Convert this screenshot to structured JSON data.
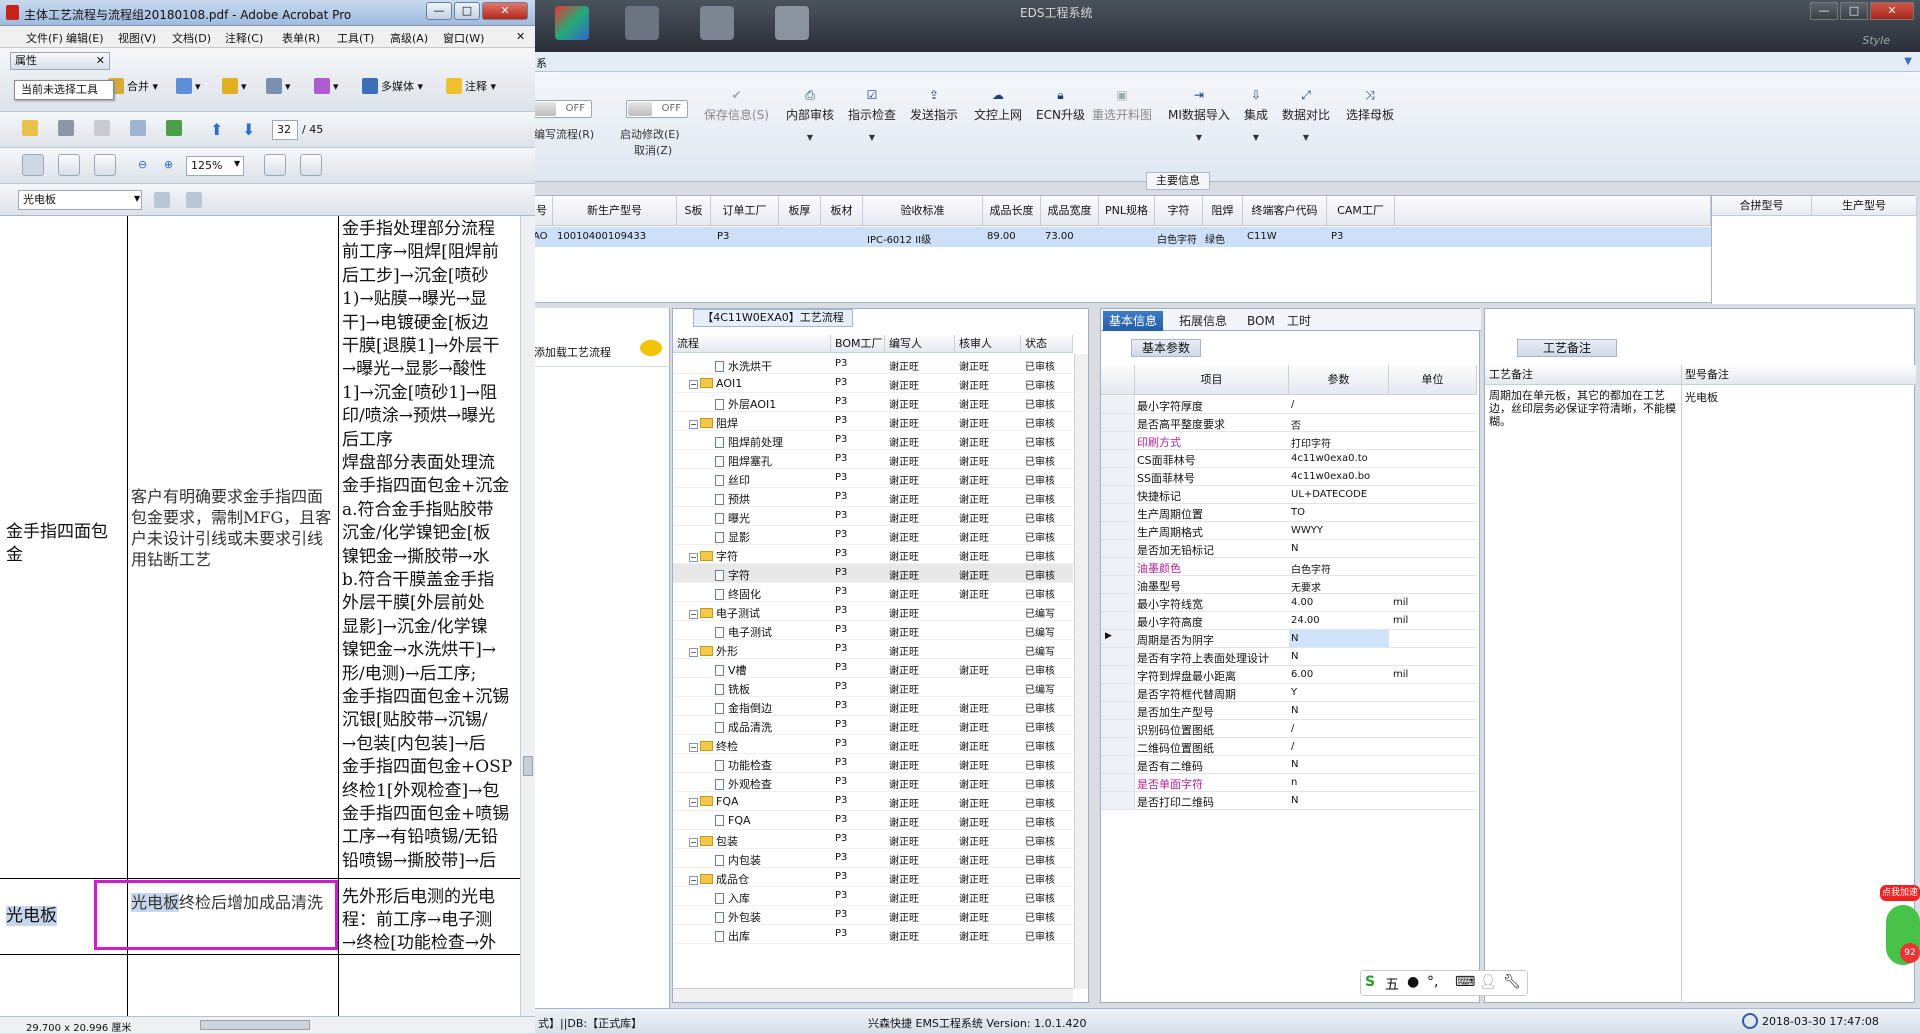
{
  "eds": {
    "title": "EDS工程系统",
    "style_label": "Style",
    "menu_tab": "系",
    "toggles": [
      {
        "value": "OFF",
        "label": "编写流程(R)"
      },
      {
        "value": "OFF",
        "label": "启动修改(E)",
        "label2": "取消(Z)"
      }
    ],
    "ribbon": [
      {
        "label": "保存信息(S)",
        "disabled": true
      },
      {
        "label": "内部审核"
      },
      {
        "label": "指示检查"
      },
      {
        "label": "发送指示"
      },
      {
        "label": "文控上网"
      },
      {
        "label": "ECN升级"
      },
      {
        "label": "重选开料图",
        "disabled": true
      },
      {
        "label": "MI数据导入"
      },
      {
        "label": "集成"
      },
      {
        "label": "数据对比"
      },
      {
        "label": "选择母板"
      }
    ],
    "group_label": "主要信息",
    "info_headers": [
      "号",
      "新生产型号",
      "S板",
      "订单工厂",
      "板厚",
      "板材",
      "验收标准",
      "成品长度",
      "成品宽度",
      "PNL规格",
      "字符",
      "阻焊",
      "终端客户代码",
      "CAM工厂"
    ],
    "info_headers_right": [
      "合拼型号",
      "生产型号"
    ],
    "info_row": [
      "AO",
      "10010400109433",
      "",
      "P3",
      "",
      "",
      "IPC-6012 II级",
      "89.00",
      "73.00",
      "",
      "白色字符",
      "绿色",
      "C11W",
      "P3"
    ],
    "process_panel": {
      "add_label": "添加载工艺流程"
    },
    "tree": {
      "title": "【4C11W0EXA0】工艺流程",
      "headers": [
        "流程",
        "BOM工厂",
        "编写人",
        "核审人",
        "状态"
      ],
      "rows": [
        {
          "name": "水洗烘干",
          "type": "doc",
          "level": 2,
          "bom": "P3",
          "writer": "谢正旺",
          "reviewer": "谢正旺",
          "status": "已审核"
        },
        {
          "name": "AOI1",
          "type": "folder",
          "level": 1,
          "bom": "P3",
          "writer": "谢正旺",
          "reviewer": "谢正旺",
          "status": "已审核"
        },
        {
          "name": "外层AOI1",
          "type": "doc",
          "level": 2,
          "bom": "P3",
          "writer": "谢正旺",
          "reviewer": "谢正旺",
          "status": "已审核"
        },
        {
          "name": "阻焊",
          "type": "folder",
          "level": 1,
          "bom": "P3",
          "writer": "谢正旺",
          "reviewer": "谢正旺",
          "status": "已审核"
        },
        {
          "name": "阻焊前处理",
          "type": "doc",
          "level": 2,
          "bom": "P3",
          "writer": "谢正旺",
          "reviewer": "谢正旺",
          "status": "已审核"
        },
        {
          "name": "阻焊塞孔",
          "type": "doc",
          "level": 2,
          "bom": "P3",
          "writer": "谢正旺",
          "reviewer": "谢正旺",
          "status": "已审核"
        },
        {
          "name": "丝印",
          "type": "doc",
          "level": 2,
          "bom": "P3",
          "writer": "谢正旺",
          "reviewer": "谢正旺",
          "status": "已审核"
        },
        {
          "name": "预烘",
          "type": "doc",
          "level": 2,
          "bom": "P3",
          "writer": "谢正旺",
          "reviewer": "谢正旺",
          "status": "已审核"
        },
        {
          "name": "曝光",
          "type": "doc",
          "level": 2,
          "bom": "P3",
          "writer": "谢正旺",
          "reviewer": "谢正旺",
          "status": "已审核"
        },
        {
          "name": "显影",
          "type": "doc",
          "level": 2,
          "bom": "P3",
          "writer": "谢正旺",
          "reviewer": "谢正旺",
          "status": "已审核"
        },
        {
          "name": "字符",
          "type": "folder",
          "level": 1,
          "bom": "P3",
          "writer": "谢正旺",
          "reviewer": "谢正旺",
          "status": "已审核"
        },
        {
          "name": "字符",
          "type": "doc",
          "level": 2,
          "bom": "P3",
          "writer": "谢正旺",
          "reviewer": "谢正旺",
          "status": "已审核",
          "selected": true
        },
        {
          "name": "终固化",
          "type": "doc",
          "level": 2,
          "bom": "P3",
          "writer": "谢正旺",
          "reviewer": "谢正旺",
          "status": "已审核"
        },
        {
          "name": "电子测试",
          "type": "folder",
          "level": 1,
          "bom": "P3",
          "writer": "谢正旺",
          "reviewer": "",
          "status": "已编写"
        },
        {
          "name": "电子测试",
          "type": "doc",
          "level": 2,
          "bom": "P3",
          "writer": "谢正旺",
          "reviewer": "",
          "status": "已编写"
        },
        {
          "name": "外形",
          "type": "folder",
          "level": 1,
          "bom": "P3",
          "writer": "谢正旺",
          "reviewer": "",
          "status": "已编写"
        },
        {
          "name": "V槽",
          "type": "doc",
          "level": 2,
          "bom": "P3",
          "writer": "谢正旺",
          "reviewer": "谢正旺",
          "status": "已审核"
        },
        {
          "name": "铣板",
          "type": "doc",
          "level": 2,
          "bom": "P3",
          "writer": "谢正旺",
          "reviewer": "",
          "status": "已编写"
        },
        {
          "name": "金指倒边",
          "type": "doc",
          "level": 2,
          "bom": "P3",
          "writer": "谢正旺",
          "reviewer": "谢正旺",
          "status": "已审核"
        },
        {
          "name": "成品清洗",
          "type": "doc",
          "level": 2,
          "bom": "P3",
          "writer": "谢正旺",
          "reviewer": "谢正旺",
          "status": "已审核"
        },
        {
          "name": "终检",
          "type": "folder",
          "level": 1,
          "bom": "P3",
          "writer": "谢正旺",
          "reviewer": "谢正旺",
          "status": "已审核"
        },
        {
          "name": "功能检查",
          "type": "doc",
          "level": 2,
          "bom": "P3",
          "writer": "谢正旺",
          "reviewer": "谢正旺",
          "status": "已审核"
        },
        {
          "name": "外观检查",
          "type": "doc",
          "level": 2,
          "bom": "P3",
          "writer": "谢正旺",
          "reviewer": "谢正旺",
          "status": "已审核"
        },
        {
          "name": "FQA",
          "type": "folder",
          "level": 1,
          "bom": "P3",
          "writer": "谢正旺",
          "reviewer": "谢正旺",
          "status": "已审核"
        },
        {
          "name": "FQA",
          "type": "doc",
          "level": 2,
          "bom": "P3",
          "writer": "谢正旺",
          "reviewer": "谢正旺",
          "status": "已审核"
        },
        {
          "name": "包装",
          "type": "folder",
          "level": 1,
          "bom": "P3",
          "writer": "谢正旺",
          "reviewer": "谢正旺",
          "status": "已审核"
        },
        {
          "name": "内包装",
          "type": "doc",
          "level": 2,
          "bom": "P3",
          "writer": "谢正旺",
          "reviewer": "谢正旺",
          "status": "已审核"
        },
        {
          "name": "成品仓",
          "type": "folder",
          "level": 1,
          "bom": "P3",
          "writer": "谢正旺",
          "reviewer": "谢正旺",
          "status": "已审核"
        },
        {
          "name": "入库",
          "type": "doc",
          "level": 2,
          "bom": "P3",
          "writer": "谢正旺",
          "reviewer": "谢正旺",
          "status": "已审核"
        },
        {
          "name": "外包装",
          "type": "doc",
          "level": 2,
          "bom": "P3",
          "writer": "谢正旺",
          "reviewer": "谢正旺",
          "status": "已审核"
        },
        {
          "name": "出库",
          "type": "doc",
          "level": 2,
          "bom": "P3",
          "writer": "谢正旺",
          "reviewer": "谢正旺",
          "status": "已审核"
        }
      ]
    },
    "basic": {
      "tabs": [
        "基本信息",
        "拓展信息",
        "BOM",
        "工时"
      ],
      "subtab": "基本参数",
      "headers": [
        "项目",
        "参数",
        "单位"
      ],
      "rows": [
        {
          "k": "最小字符厚度",
          "v": "/",
          "u": ""
        },
        {
          "k": "是否高平整度要求",
          "v": "否",
          "u": ""
        },
        {
          "k": "印刷方式",
          "v": "打印字符",
          "u": "",
          "purple": true
        },
        {
          "k": "CS面菲林号",
          "v": "4c11w0exa0.to",
          "u": ""
        },
        {
          "k": "SS面菲林号",
          "v": "4c11w0exa0.bo",
          "u": ""
        },
        {
          "k": "快捷标记",
          "v": "UL+DATECODE",
          "u": ""
        },
        {
          "k": "生产周期位置",
          "v": "TO",
          "u": ""
        },
        {
          "k": "生产周期格式",
          "v": "WWYY",
          "u": ""
        },
        {
          "k": "是否加无铅标记",
          "v": "N",
          "u": ""
        },
        {
          "k": "油墨颜色",
          "v": "白色字符",
          "u": "",
          "purple": true
        },
        {
          "k": "油墨型号",
          "v": "无要求",
          "u": ""
        },
        {
          "k": "最小字符线宽",
          "v": "4.00",
          "u": "mil"
        },
        {
          "k": "最小字符高度",
          "v": "24.00",
          "u": "mil"
        },
        {
          "k": "周期是否为阴字",
          "v": "N",
          "u": "",
          "highlight": true
        },
        {
          "k": "是否有字符上表面处理设计",
          "v": "N",
          "u": ""
        },
        {
          "k": "字符到焊盘最小距离",
          "v": "6.00",
          "u": "mil"
        },
        {
          "k": "是否字符框代替周期",
          "v": "Y",
          "u": ""
        },
        {
          "k": "是否加生产型号",
          "v": "N",
          "u": ""
        },
        {
          "k": "识别码位置图纸",
          "v": "/",
          "u": ""
        },
        {
          "k": "二维码位置图纸",
          "v": "/",
          "u": ""
        },
        {
          "k": "是否有二维码",
          "v": "N",
          "u": ""
        },
        {
          "k": "是否单面字符",
          "v": "n",
          "u": "",
          "purple": true
        },
        {
          "k": "是否打印二维码",
          "v": "N",
          "u": ""
        }
      ]
    },
    "remarks": {
      "subtab": "工艺备注",
      "col1": "工艺备注",
      "col2": "型号备注",
      "note": "周期加在单元板，其它的都加在工艺边，丝印层务必保证字符清晰，不能模糊。",
      "model_note": "光电板"
    },
    "status": {
      "left": "式】||DB:【正式库】",
      "center": "兴森快捷 EMS工程系统 Version: 1.0.1.420",
      "datetime": "2018-03-30 17:47:08"
    },
    "ime": {
      "label": "五"
    },
    "widget": {
      "badge": "点我加速",
      "num": "92"
    }
  },
  "acrobat": {
    "title": "主体工艺流程与流程组20180108.pdf - Adobe Acrobat Pro",
    "menu": [
      "文件(F)",
      "编辑(E)",
      "视图(V)",
      "文档(D)",
      "注释(C)",
      "表单(R)",
      "工具(T)",
      "高级(A)",
      "窗口(W)"
    ],
    "attr_label": "属性",
    "tooltip": "当前未选择工具",
    "tb1": [
      "合并",
      "多媒体",
      "注释"
    ],
    "page_current": "32",
    "page_total": "/ 45",
    "zoom": "125%",
    "search_value": "光电板",
    "doc": {
      "right_lines": [
        "金手指处理部分流程",
        "前工序→阻焊[阻焊前",
        "后工步]→沉金[喷砂",
        "1)→贴膜→曝光→显",
        "干]→电镀硬金[板边",
        "干膜[退膜1]→外层干",
        "→曝光→显影→酸性",
        "1]→沉金[喷砂1]→阻",
        "印/喷涂→预烘→曝光",
        "后工序",
        "焊盘部分表面处理流",
        "金手指四面包金+沉金",
        "a.符合金手指贴胶带",
        "沉金/化学镍钯金[板",
        "镍钯金→撕胶带→水",
        "b.符合干膜盖金手指",
        "外层干膜[外层前处",
        "显影]→沉金/化学镍",
        "镍钯金→水洗烘干]→",
        "形/电测)→后工序;",
        "金手指四面包金+沉锡",
        "沉银[贴胶带→沉锡/",
        "→包装[内包装]→后",
        "金手指四面包金+OSP",
        "终检1[外观检查]→包",
        "金手指四面包金+喷锡",
        "工序→有铅喷锡/无铅",
        "铅喷锡→撕胶带]→后"
      ],
      "row1_name": "金手指四面包金",
      "row1_mid": "客户有明确要求金手指四面包金要求，需制MFG，且客户未设计引线或未要求引线用钻断工艺",
      "row2_name": "光电板",
      "row2_mid_hl": "光电板",
      "row2_mid_rest": "终检后增加成品清洗",
      "row2_right": [
        "先外形后电测的光电",
        "程：前工序→电子测",
        "→终检[功能检查→外"
      ]
    },
    "page_size": "29.700 x 20.996 厘米"
  },
  "colors": {
    "accent": "#245ca6",
    "highlight_box": "#d01bd0",
    "purple_text": "#b0229a"
  }
}
